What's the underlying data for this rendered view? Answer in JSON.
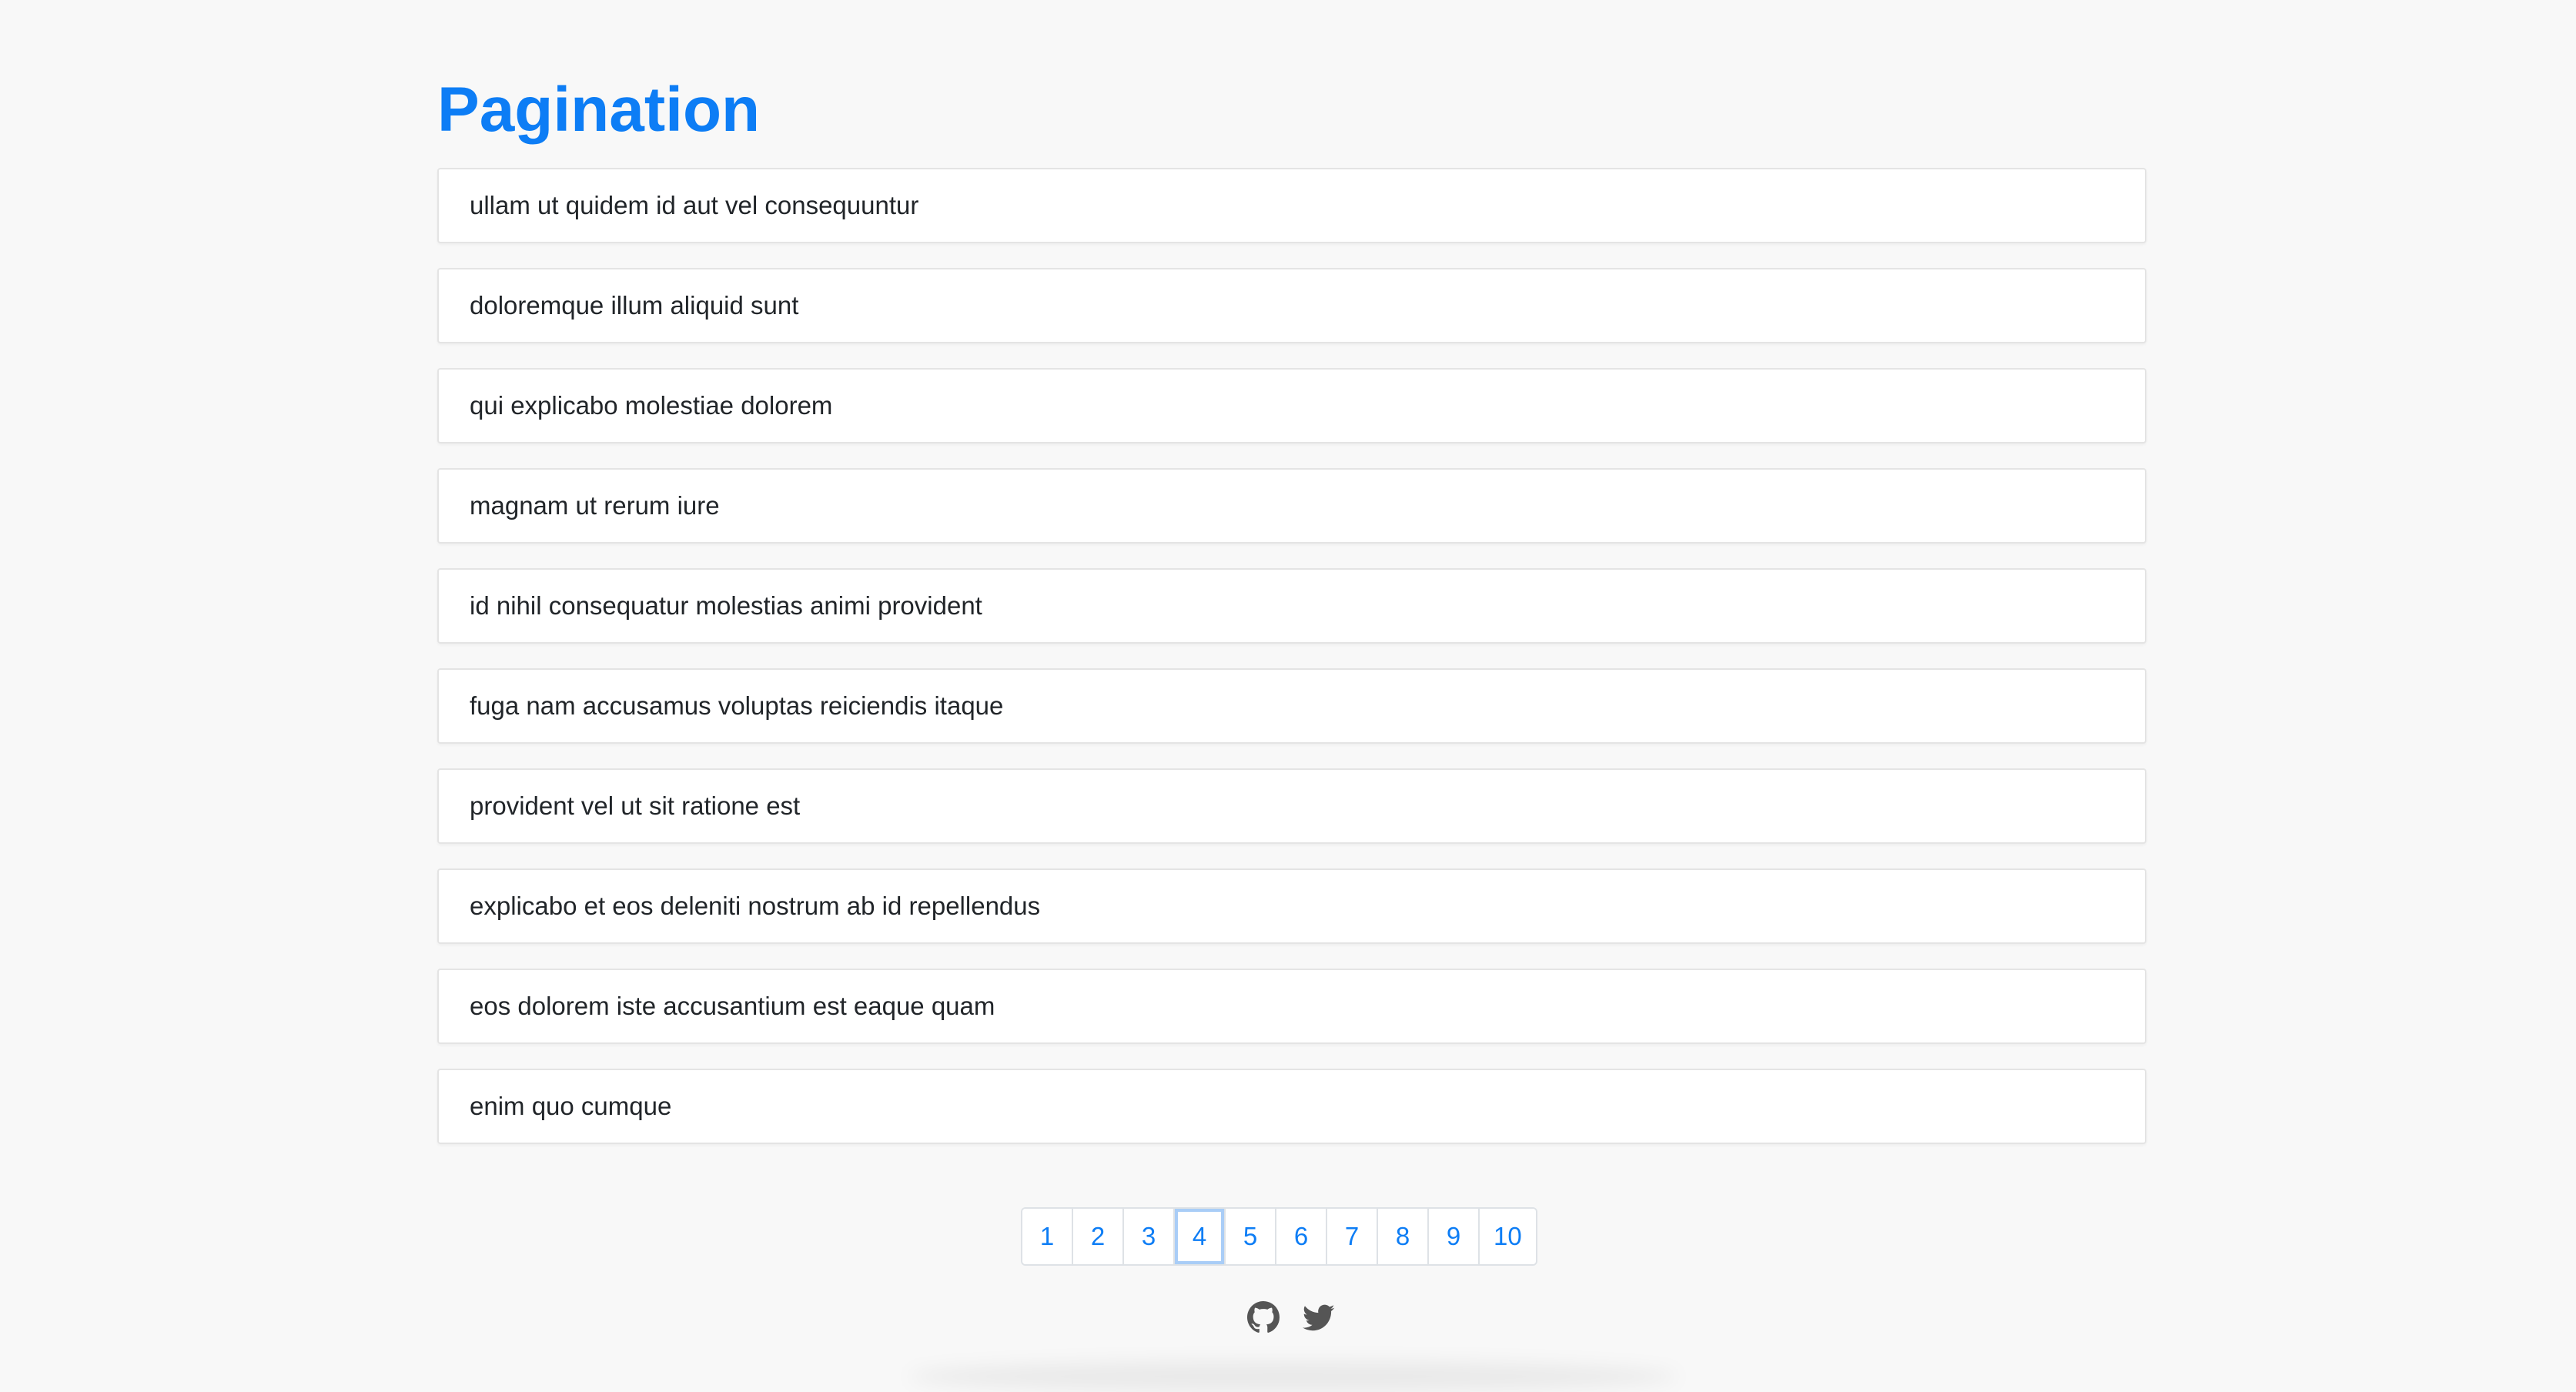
{
  "header": {
    "title": "Pagination"
  },
  "posts": [
    "ullam ut quidem id aut vel consequuntur",
    "doloremque illum aliquid sunt",
    "qui explicabo molestiae dolorem",
    "magnam ut rerum iure",
    "id nihil consequatur molestias animi provident",
    "fuga nam accusamus voluptas reiciendis itaque",
    "provident vel ut sit ratione est",
    "explicabo et eos deleniti nostrum ab id repellendus",
    "eos dolorem iste accusantium est eaque quam",
    "enim quo cumque"
  ],
  "pagination": {
    "pages": [
      "1",
      "2",
      "3",
      "4",
      "5",
      "6",
      "7",
      "8",
      "9",
      "10"
    ],
    "current": "4"
  },
  "footer": {
    "icons": [
      "github-icon",
      "twitter-icon"
    ]
  },
  "colors": {
    "accent": "#0d7df5",
    "background": "#f8f8f8",
    "active_outline": "#a9cdf7"
  }
}
